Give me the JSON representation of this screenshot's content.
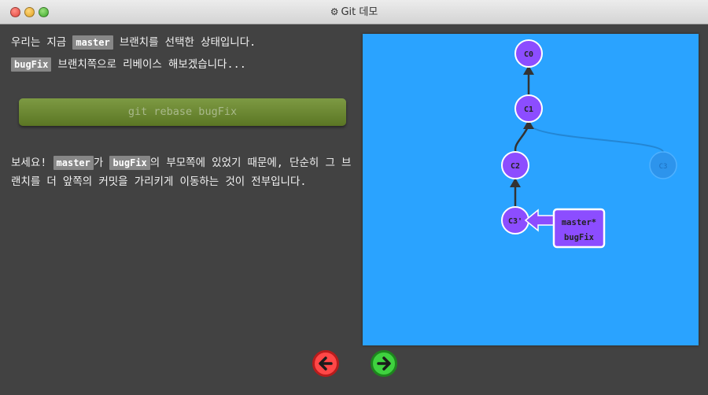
{
  "window": {
    "title": "Git 데모",
    "title_icon": "gear-icon"
  },
  "intro": {
    "p1_prefix": "우리는 지금 ",
    "master_tag": "master",
    "p1_suffix": " 브랜치를 선택한 상태입니다.",
    "bugfix_tag": "bugFix",
    "p2_suffix": " 브랜치쪽으로 리베이스 해보겠습니다..."
  },
  "command": {
    "label": "git rebase bugFix"
  },
  "explain": {
    "prefix": "보세요! ",
    "master_tag": "master",
    "mid1": "가 ",
    "bugfix_tag": "bugFix",
    "rest": "의 부모쪽에 있었기 때문에, 단순히 그 브랜치를 더 앞쪽의 커밋을 가리키게 이동하는 것이 전부입니다."
  },
  "graph": {
    "background": "#2aa3ff",
    "commit_color": "#8c4dff",
    "commits": {
      "c0": "C0",
      "c1": "C1",
      "c2": "C2",
      "c3prime": "C3'",
      "c3": "C3"
    },
    "branch_label": {
      "line1": "master*",
      "line2": "bugFix"
    }
  },
  "navigation": {
    "prev_icon": "arrow-left-icon",
    "next_icon": "arrow-right-icon",
    "prev_color": "#ff4747",
    "next_color": "#3fd23f"
  }
}
